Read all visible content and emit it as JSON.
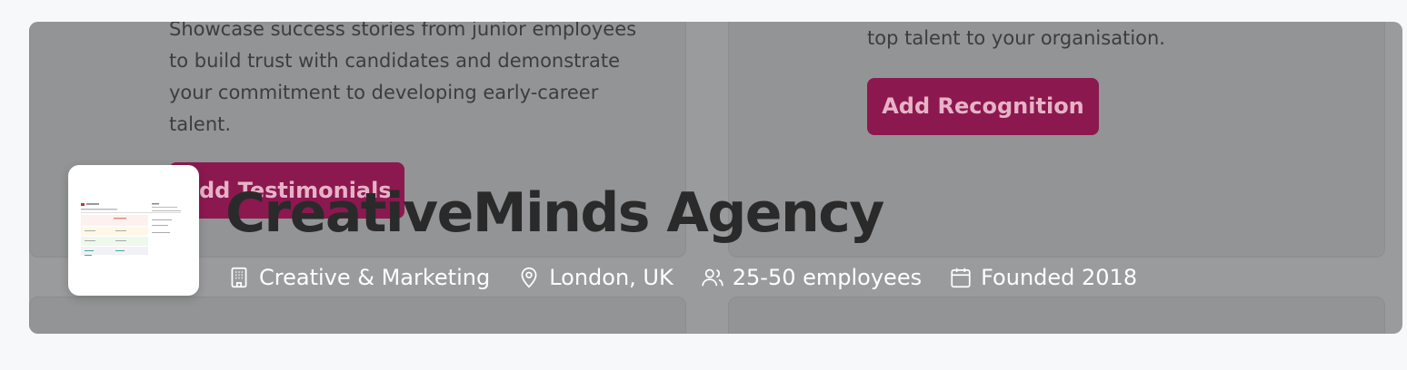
{
  "cards": {
    "testimonials": {
      "description": "Showcase success stories from junior employees to build trust with candidates and demonstrate your commitment to developing early-career talent.",
      "button_label": "Add Testimonials"
    },
    "recognition": {
      "description": "top talent to your organisation.",
      "button_label": "Add Recognition"
    }
  },
  "company": {
    "name": "CreativeMinds Agency",
    "logo_icon": "company-logo-thumbnail",
    "meta": {
      "industry": "Creative & Marketing",
      "location": "London, UK",
      "size": "25-50 employees",
      "founded": "Founded 2018"
    }
  },
  "colors": {
    "accent": "#8c1850",
    "overlay": "#9a9b9d",
    "page_background": "#f7f8fa"
  }
}
